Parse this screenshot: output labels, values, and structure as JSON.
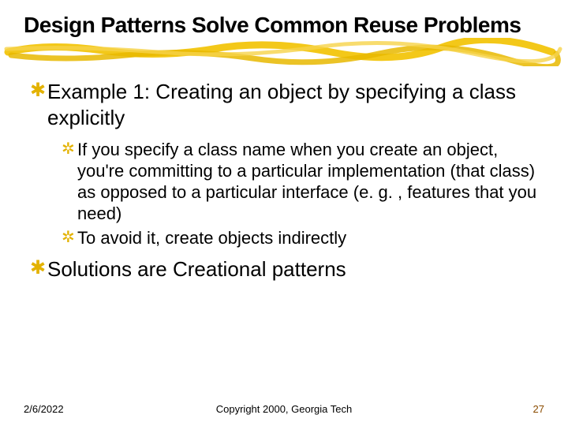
{
  "title": "Design Patterns Solve Common Reuse Problems",
  "bullets": [
    {
      "text": "Example 1: Creating an object by specifying a class explicitly",
      "sub": [
        "If you specify a class name when you create an object, you're committing to a particular implementation (that class) as opposed to a particular interface (e. g. , features that you need)",
        "To avoid it, create objects indirectly"
      ]
    },
    {
      "text": "Solutions are Creational patterns",
      "sub": []
    }
  ],
  "footer": {
    "date": "2/6/2022",
    "copyright": "Copyright 2000, Georgia Tech",
    "page": "27"
  },
  "colors": {
    "accent": "#e3b200",
    "pageNumber": "#8a4b00"
  }
}
